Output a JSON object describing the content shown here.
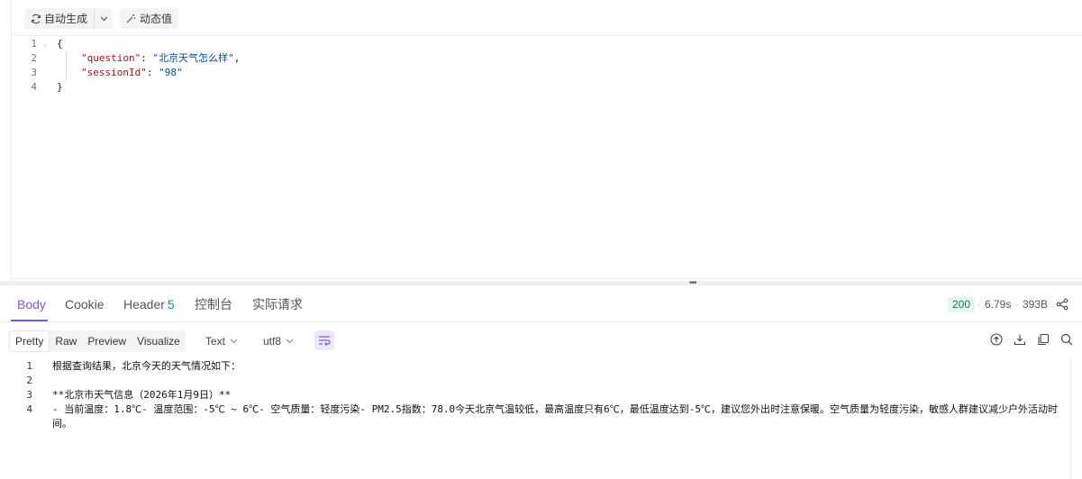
{
  "request": {
    "toolbar": {
      "auto_generate_label": "自动生成",
      "dynamic_value_label": "动态值"
    },
    "editor": {
      "line_numbers": [
        "1",
        "2",
        "3",
        "4"
      ],
      "open_brace": "{",
      "close_brace": "}",
      "fields": [
        {
          "key": "\"question\"",
          "colon": ": ",
          "value": "\"北京天气怎么样\"",
          "comma": ","
        },
        {
          "key": "\"sessionId\"",
          "colon": ": ",
          "value": "\"98\"",
          "comma": ""
        }
      ]
    }
  },
  "response": {
    "tabs": [
      {
        "label": "Body",
        "active": true
      },
      {
        "label": "Cookie"
      },
      {
        "label": "Header",
        "count": "5"
      },
      {
        "label": "控制台"
      },
      {
        "label": "实际请求"
      }
    ],
    "status_code": "200",
    "time": "6.79s",
    "size": "393B",
    "view_modes": [
      "Pretty",
      "Raw",
      "Preview",
      "Visualize"
    ],
    "active_view": "Pretty",
    "format_select": "Text",
    "encoding_select": "utf8",
    "body_lines": [
      {
        "num": "1",
        "text": "根据查询结果，北京今天的天气情况如下："
      },
      {
        "num": "2",
        "text": ""
      },
      {
        "num": "3",
        "text": "**北京市天气信息（2026年1月9日）**"
      },
      {
        "num": "4",
        "text": "- 当前温度：1.8℃- 温度范围：-5℃ ~ 6℃- 空气质量：轻度污染- PM2.5指数：78.0今天北京气温较低，最高温度只有6℃，最低温度达到-5℃，建议您外出时注意保暖。空气质量为轻度污染，敏感人群建议减少户外活动时间。"
      }
    ]
  },
  "colors": {
    "accent": "#7c5bd6",
    "status_ok": "#15803d",
    "json_key": "#a31515",
    "json_string": "#0451a5"
  }
}
